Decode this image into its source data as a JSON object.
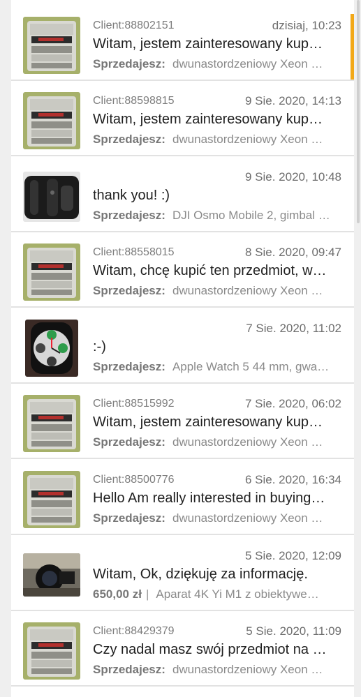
{
  "conversations": [
    {
      "client": "Client:88802151",
      "date": "dzisiaj, 10:23",
      "message": "Witam, jestem zainteresowany kup…",
      "seller_label": "Sprzedajesz:",
      "item": "dwunastordzeniowy Xeon …",
      "thumb": "mac-pro-icon",
      "unread": true
    },
    {
      "client": "Client:88598815",
      "date": "9 Sie. 2020, 14:13",
      "message": "Witam, jestem zainteresowany kup…",
      "seller_label": "Sprzedajesz:",
      "item": "dwunastordzeniowy Xeon …",
      "thumb": "mac-pro-icon"
    },
    {
      "client": "",
      "date": "9 Sie. 2020, 10:48",
      "message": "thank you! :)",
      "seller_label": "Sprzedajesz:",
      "item": "DJI Osmo Mobile 2, gimbal …",
      "thumb": "gimbal-icon"
    },
    {
      "client": "Client:88558015",
      "date": "8 Sie. 2020, 09:47",
      "message": "Witam, chcę kupić ten przedmiot, w…",
      "seller_label": "Sprzedajesz:",
      "item": "dwunastordzeniowy Xeon …",
      "thumb": "mac-pro-icon"
    },
    {
      "client": "",
      "date": "7 Sie. 2020, 11:02",
      "message": ":-)",
      "seller_label": "Sprzedajesz:",
      "item": "Apple Watch 5 44 mm, gwa…",
      "thumb": "apple-watch-icon"
    },
    {
      "client": "Client:88515992",
      "date": "7 Sie. 2020, 06:02",
      "message": "Witam, jestem zainteresowany kup…",
      "seller_label": "Sprzedajesz:",
      "item": "dwunastordzeniowy Xeon …",
      "thumb": "mac-pro-icon"
    },
    {
      "client": "Client:88500776",
      "date": "6 Sie. 2020, 16:34",
      "message": "Hello Am really interested in buying…",
      "seller_label": "Sprzedajesz:",
      "item": "dwunastordzeniowy Xeon …",
      "thumb": "mac-pro-icon"
    },
    {
      "client": "",
      "date": "5 Sie. 2020, 12:09",
      "message": "Witam, Ok, dziękuję za informację.",
      "price": "650,00 zł",
      "item": "Aparat 4K Yi M1 z obiektywe…",
      "thumb": "camera-icon"
    },
    {
      "client": "Client:88429379",
      "date": "5 Sie. 2020, 11:09",
      "message": "Czy nadal masz swój przedmiot na …",
      "seller_label": "Sprzedajesz:",
      "item": "dwunastordzeniowy Xeon …",
      "thumb": "mac-pro-icon"
    }
  ]
}
